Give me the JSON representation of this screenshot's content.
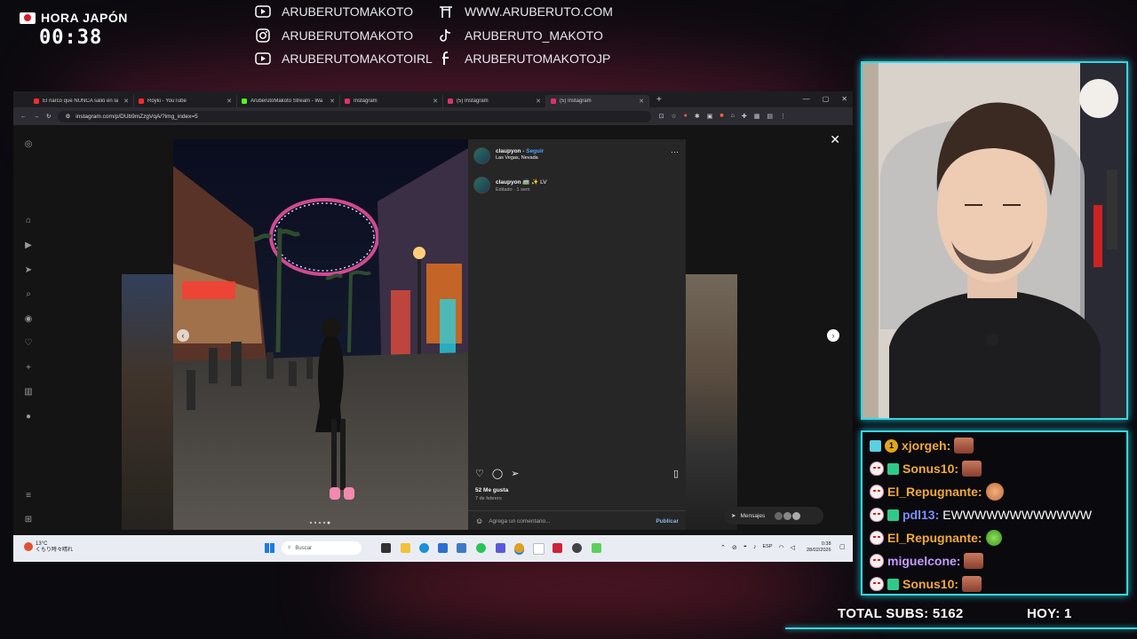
{
  "stream_overlay": {
    "clock_label": "HORA JAPÓN",
    "clock_time": "00:38",
    "socials_left": [
      {
        "icon": "youtube-icon",
        "text": "ARUBERUTOMAKOTO"
      },
      {
        "icon": "instagram-icon",
        "text": "ARUBERUTOMAKOTO"
      },
      {
        "icon": "youtube-icon",
        "text": "ARUBERUTOMAKOTOIRL"
      }
    ],
    "socials_right": [
      {
        "icon": "torii-icon",
        "text": "WWW.ARUBERUTO.COM"
      },
      {
        "icon": "tiktok-icon",
        "text": "ARUBERUTO_MAKOTO"
      },
      {
        "icon": "facebook-icon",
        "text": "ARUBERUTOMAKOTOJP"
      }
    ],
    "total_subs": "TOTAL SUBS: 5162",
    "today": "HOY: 1",
    "accent_color": "#36d6e0"
  },
  "browser": {
    "tabs": [
      {
        "label": "El narco que NUNCA salió en la",
        "icon": "youtube-icon",
        "color": "#ff2a2a",
        "active": false
      },
      {
        "label": "Royki - YouTube",
        "icon": "youtube-icon",
        "color": "#ff2a2a",
        "active": false
      },
      {
        "label": "AruberutoMakoto Stream - Wa",
        "icon": "kick-icon",
        "color": "#53fc18",
        "active": false
      },
      {
        "label": "Instagram",
        "icon": "instagram-icon",
        "color": "#e1306c",
        "active": false
      },
      {
        "label": "(5) Instagram",
        "icon": "instagram-icon",
        "color": "#e1306c",
        "active": false
      },
      {
        "label": "(5) Instagram",
        "icon": "instagram-icon",
        "color": "#e1306c",
        "active": true
      }
    ],
    "new_tab": "+",
    "url": "instagram.com/p/DUb9mZzgVqA/?img_index=5"
  },
  "instagram_post": {
    "username": "claupyon",
    "follow": "Seguir",
    "separator": "•",
    "location": "Las Vegas, Nevada",
    "caption_user": "claupyon",
    "caption": "🚎 ✨ LV",
    "caption_meta": "Editado · 1 sem",
    "likes": "52 Me gusta",
    "date": "7 de febrero",
    "comment_placeholder": "Agrega un comentario...",
    "publish": "Publicar",
    "messages": "Mensajes"
  },
  "taskbar": {
    "weather_temp": "13°C",
    "weather_desc": "くもり時々晴れ",
    "search_placeholder": "Buscar",
    "lang": "ESP",
    "time": "0:38",
    "date": "28/02/2026"
  },
  "chat": {
    "messages": [
      {
        "user": "xjorgeh:",
        "color": "#f2a93b",
        "badges": [
          "sub",
          "number"
        ],
        "badge_number": "1",
        "text": "",
        "emote": "square"
      },
      {
        "user": "Sonus10:",
        "color": "#f2a93b",
        "badges": [
          "mask",
          "gift"
        ],
        "text": "",
        "emote": "square"
      },
      {
        "user": "El_Repugnante:",
        "color": "#f2a93b",
        "badges": [
          "mask"
        ],
        "text": "",
        "emote": "face"
      },
      {
        "user": "pdl13:",
        "color": "#7b8cff",
        "badges": [
          "mask",
          "gift"
        ],
        "text": "EWWWWWWWWWWWW",
        "emote": ""
      },
      {
        "user": "El_Repugnante:",
        "color": "#f2a93b",
        "badges": [
          "mask"
        ],
        "text": "",
        "emote": "green"
      },
      {
        "user": "miguelcone:",
        "color": "#c49bff",
        "badges": [
          "mask"
        ],
        "text": "",
        "emote": "square"
      },
      {
        "user": "Sonus10:",
        "color": "#f2a93b",
        "badges": [
          "mask",
          "gift"
        ],
        "text": "",
        "emote": "square"
      }
    ]
  }
}
